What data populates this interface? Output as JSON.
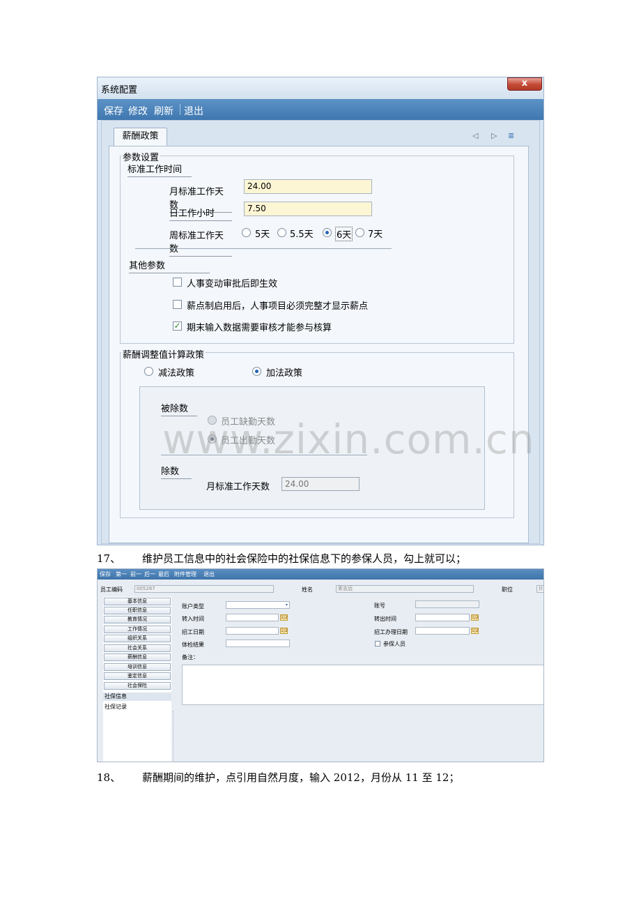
{
  "dialog": {
    "title": "系统配置",
    "close_glyph": "x",
    "toolbar": {
      "save": "保存",
      "edit": "修改",
      "refresh": "刷新",
      "exit": "退出"
    },
    "tab": "薪酬政策",
    "nav_icons": [
      "triangle-left-icon",
      "triangle-right-icon",
      "list-icon"
    ],
    "param_group": "参数设置",
    "std_work_time": "标准工作时间",
    "monthly_days_label": "月标准工作天数",
    "monthly_days_value": "24.00",
    "daily_hours_label": "日工作小时",
    "daily_hours_value": "7.50",
    "weekly_days_label": "周标准工作天数",
    "weekly_options": [
      {
        "label": "5天",
        "selected": false
      },
      {
        "label": "5.5天",
        "selected": false
      },
      {
        "label": "6天",
        "selected": true
      },
      {
        "label": "7天",
        "selected": false
      }
    ],
    "other_params": "其他参数",
    "checks": [
      {
        "label": "人事变动审批后即生效",
        "checked": false
      },
      {
        "label": "薪点制启用后，人事项目必须完整才显示薪点",
        "checked": false
      },
      {
        "label": "期末输入数据需要审核才能参与核算",
        "checked": true
      }
    ],
    "adjust_group": "薪酬调整值计算政策",
    "subtract_policy": "减法政策",
    "add_policy": "加法政策",
    "dividend": "被除数",
    "absent_days": "员工缺勤天数",
    "attend_days": "员工出勤天数",
    "divisor": "除数",
    "divisor_label": "月标准工作天数",
    "divisor_value": "24.00",
    "watermark": "www.zixin.com.cn"
  },
  "captions": {
    "c17_num": "17、",
    "c17_text": "维护员工信息中的社会保险中的社保信息下的参保人员，勾上就可以；",
    "c18_num": "18、",
    "c18_text": "薪酬期间的维护，点引用自然月度，输入 2012，月份从 11 至 12；"
  },
  "employee": {
    "toolbar": [
      "保存",
      "第一",
      "前一",
      "后一",
      "最后",
      "附件管理",
      "退出"
    ],
    "emp_code_label": "员工编码",
    "emp_code_value": "005267",
    "name_label": "姓名",
    "name_value": "索志远",
    "position_label": "职位",
    "position_value": "片区",
    "nav_items": [
      "基本信息",
      "任职信息",
      "教育情况",
      "工作情况",
      "组织关系",
      "社会关系",
      "薪酬信息",
      "培训信息",
      "鉴定信息",
      "社会保险"
    ],
    "sub_items": [
      "社保信息",
      "社保记录"
    ],
    "account_type_label": "账户类型",
    "account_no_label": "账号",
    "transfer_in_label": "转入时间",
    "transfer_out_label": "转出时间",
    "hire_date_label": "招工日期",
    "hire_proc_label": "招工办理日期",
    "exam_label": "体检结果",
    "insured_label": "参保人员",
    "note_label": "备注：",
    "calendar_glyph": "1|2"
  }
}
